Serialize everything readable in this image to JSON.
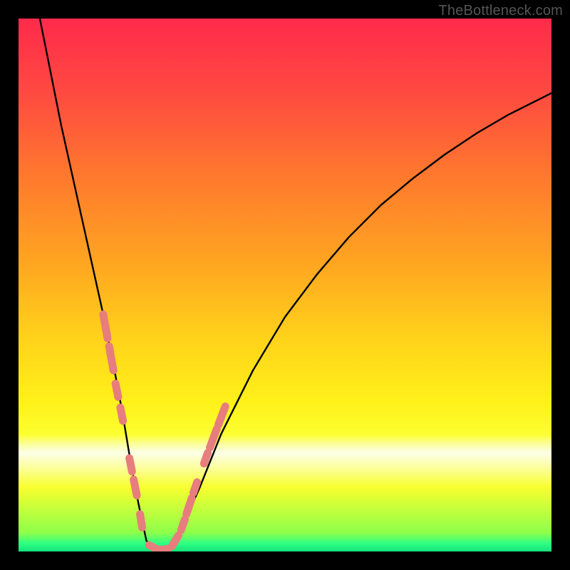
{
  "watermark": "TheBottleneck.com",
  "gradient": {
    "stops": [
      {
        "offset": 0.0,
        "color": "#ff2a4b"
      },
      {
        "offset": 0.14,
        "color": "#ff4a41"
      },
      {
        "offset": 0.3,
        "color": "#ff7a2d"
      },
      {
        "offset": 0.45,
        "color": "#ffa321"
      },
      {
        "offset": 0.6,
        "color": "#ffd21a"
      },
      {
        "offset": 0.72,
        "color": "#fff11a"
      },
      {
        "offset": 0.78,
        "color": "#fcff2f"
      },
      {
        "offset": 0.8,
        "color": "#fbffa4"
      },
      {
        "offset": 0.815,
        "color": "#fcffe8"
      },
      {
        "offset": 0.84,
        "color": "#fcffa4"
      },
      {
        "offset": 0.88,
        "color": "#f8ff2e"
      },
      {
        "offset": 0.965,
        "color": "#8dff4a"
      },
      {
        "offset": 0.985,
        "color": "#2dff83"
      },
      {
        "offset": 1.0,
        "color": "#14e27a"
      }
    ]
  },
  "chart_data": {
    "type": "line",
    "title": "",
    "xlabel": "",
    "ylabel": "",
    "xlim": [
      0,
      100
    ],
    "ylim": [
      0,
      100
    ],
    "series": [
      {
        "name": "bottleneck-curve",
        "x": [
          4,
          6,
          8,
          10,
          12,
          14,
          16,
          18,
          19.5,
          21,
          22.5,
          24,
          26,
          28,
          30,
          34,
          38,
          44,
          50,
          56,
          62,
          68,
          74,
          80,
          86,
          92,
          98,
          100
        ],
        "y": [
          100,
          90,
          80,
          71,
          62,
          53,
          44,
          34,
          26,
          17,
          9,
          2,
          0,
          0,
          3,
          12,
          22,
          34,
          44,
          52,
          59,
          65,
          70,
          74.5,
          78.5,
          82,
          85,
          86
        ]
      }
    ],
    "markers": {
      "name": "dash-markers",
      "color": "#e77d7d",
      "segments": [
        {
          "x1": 15.9,
          "y1": 44.5,
          "x2": 16.7,
          "y2": 40.0
        },
        {
          "x1": 17.0,
          "y1": 38.5,
          "x2": 17.8,
          "y2": 34.0
        },
        {
          "x1": 18.2,
          "y1": 31.5,
          "x2": 18.7,
          "y2": 29.0
        },
        {
          "x1": 19.1,
          "y1": 27.0,
          "x2": 19.6,
          "y2": 24.5
        },
        {
          "x1": 20.8,
          "y1": 17.5,
          "x2": 21.3,
          "y2": 15.0
        },
        {
          "x1": 21.6,
          "y1": 13.5,
          "x2": 22.2,
          "y2": 10.5
        },
        {
          "x1": 22.8,
          "y1": 7.0,
          "x2": 23.2,
          "y2": 4.5
        },
        {
          "x1": 24.5,
          "y1": 1.2,
          "x2": 25.8,
          "y2": 0.5
        },
        {
          "x1": 26.5,
          "y1": 0.3,
          "x2": 28.0,
          "y2": 0.5
        },
        {
          "x1": 28.8,
          "y1": 1.0,
          "x2": 30.0,
          "y2": 3.0
        },
        {
          "x1": 30.5,
          "y1": 4.0,
          "x2": 31.2,
          "y2": 6.0
        },
        {
          "x1": 31.5,
          "y1": 7.0,
          "x2": 32.5,
          "y2": 10.0
        },
        {
          "x1": 32.8,
          "y1": 11.0,
          "x2": 33.5,
          "y2": 13.0
        },
        {
          "x1": 34.8,
          "y1": 16.5,
          "x2": 35.5,
          "y2": 18.5
        },
        {
          "x1": 35.9,
          "y1": 19.5,
          "x2": 37.2,
          "y2": 23.0
        },
        {
          "x1": 37.5,
          "y1": 23.8,
          "x2": 38.8,
          "y2": 27.2
        }
      ]
    }
  }
}
